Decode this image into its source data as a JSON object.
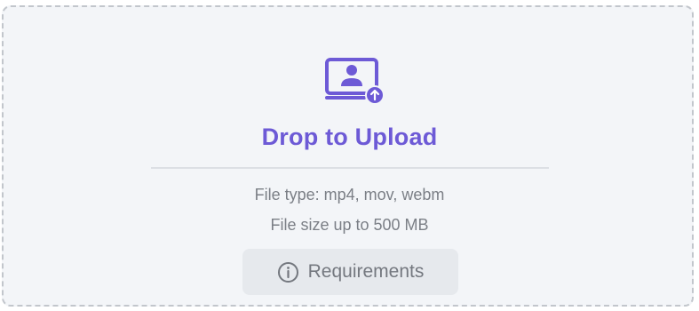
{
  "upload": {
    "icon": "upload-video-icon",
    "title": "Drop to Upload",
    "file_type_text": "File type: mp4, mov, webm",
    "file_size_text": "File size up to 500 MB",
    "requirements_label": "Requirements",
    "requirements_icon": "info-icon"
  },
  "colors": {
    "accent": "#6d5ad6",
    "background": "#f3f5f8",
    "border": "#c2c6cc",
    "muted_text": "#7b7f86",
    "button_bg": "#e6e9ed"
  }
}
